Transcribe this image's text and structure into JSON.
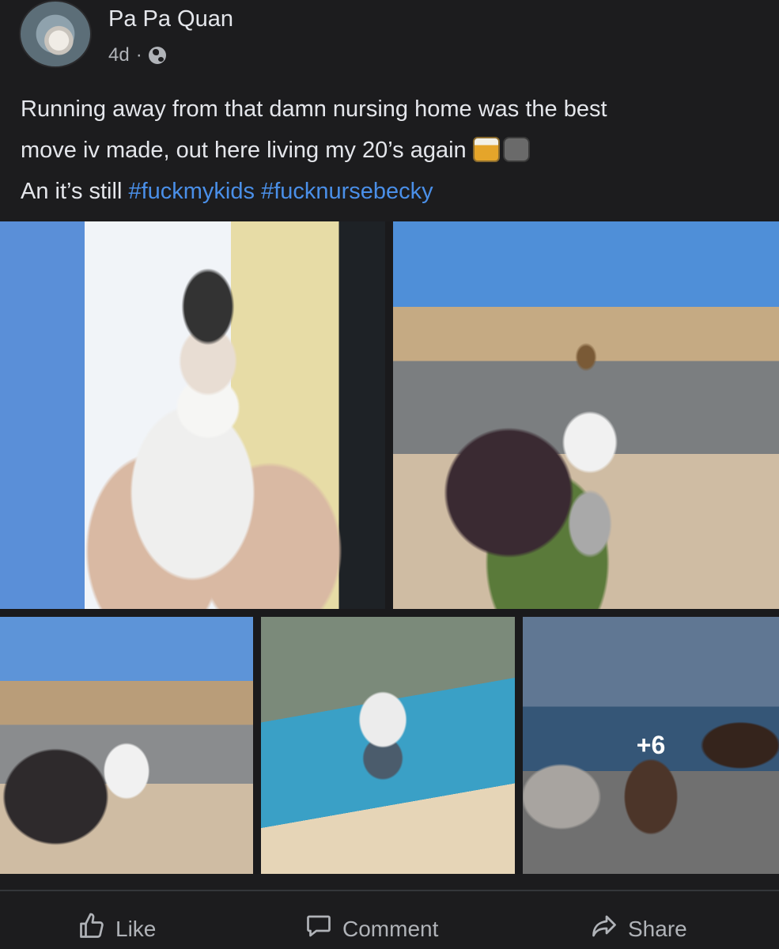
{
  "post": {
    "author": "Pa Pa Quan",
    "time": "4d",
    "separator": "·",
    "privacy_icon": "globe-icon",
    "text_line1": "Running away from that damn nursing home was the best",
    "text_line2": "move iv made, out here living my 20’s again",
    "text_line3_prefix": "An it’s still",
    "hashtag1": "#fuckmykids",
    "hashtag2": "#fucknursebecky",
    "emojis": [
      "beer-mugs-emoji",
      "movie-camera-emoji"
    ],
    "hashtag_color": "#4a8fe8"
  },
  "photos": {
    "more_count": "+6"
  },
  "actions": {
    "like": "Like",
    "comment": "Comment",
    "share": "Share"
  }
}
